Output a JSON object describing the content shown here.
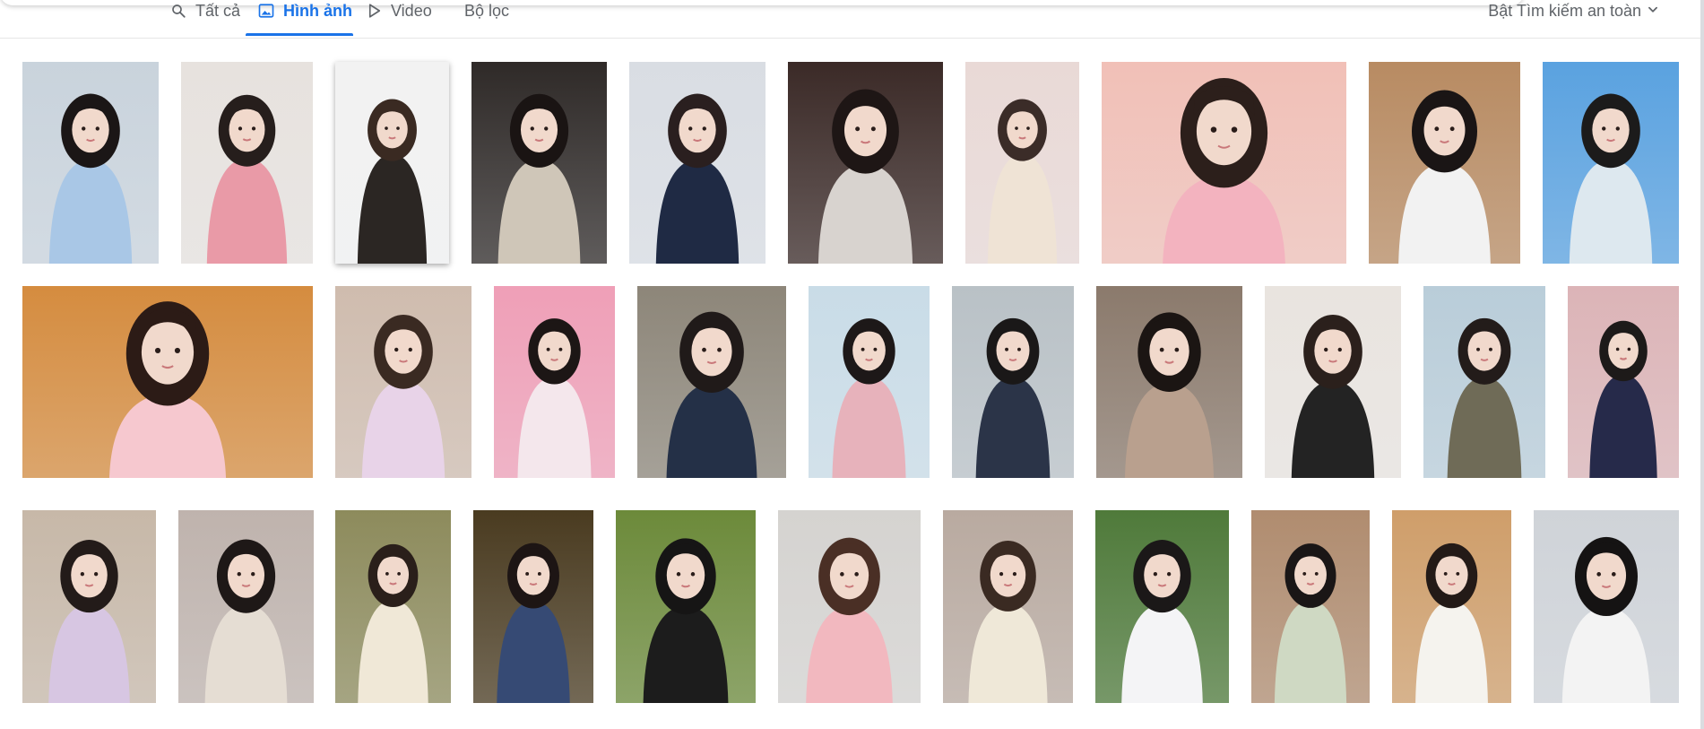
{
  "tabs": [
    {
      "label": "Tất cả",
      "icon": "search-icon",
      "active": false
    },
    {
      "label": "Hình ảnh",
      "icon": "image-icon",
      "active": true
    },
    {
      "label": "Video",
      "icon": "play-icon",
      "active": false
    },
    {
      "label": "Bộ lọc",
      "icon": "",
      "active": false
    }
  ],
  "safe_search": {
    "label": "Bật Tìm kiếm an toàn",
    "icon": "chevron-down-icon"
  },
  "colors": {
    "accent": "#1a73e8",
    "text": "#5f6368",
    "tile_bg": "#eef1f5"
  },
  "images": [
    {
      "row": 1,
      "tones": [
        "#c9d3dc",
        "#1b1616",
        "#a9c7e6"
      ]
    },
    {
      "row": 1,
      "tones": [
        "#e7e2de",
        "#261e1c",
        "#e99aa7"
      ]
    },
    {
      "row": 1,
      "tones": [
        "#f2f2f2",
        "#3a2a22",
        "#2b2623"
      ]
    },
    {
      "row": 1,
      "tones": [
        "#2f2a28",
        "#1a1413",
        "#cfc6b8"
      ]
    },
    {
      "row": 1,
      "tones": [
        "#d9dde3",
        "#2a1f1f",
        "#1f2a44"
      ]
    },
    {
      "row": 1,
      "tones": [
        "#3b2a27",
        "#1e1615",
        "#d8d3cf"
      ]
    },
    {
      "row": 1,
      "tones": [
        "#e9d9d6",
        "#3b2c28",
        "#efe3d5"
      ]
    },
    {
      "row": 1,
      "tones": [
        "#f1c0b7",
        "#2c1f1b",
        "#f3b3bf"
      ]
    },
    {
      "row": 1,
      "tones": [
        "#b88b62",
        "#1a1515",
        "#f2f2f2"
      ]
    },
    {
      "row": 1,
      "tones": [
        "#5aa2e0",
        "#1c1b1b",
        "#dde8ef"
      ]
    },
    {
      "row": 2,
      "tones": [
        "#d58c3f",
        "#2c1b16",
        "#f6c8cf"
      ]
    },
    {
      "row": 2,
      "tones": [
        "#cfbcae",
        "#3a2a22",
        "#e8d3e8"
      ]
    },
    {
      "row": 2,
      "tones": [
        "#ef9fb7",
        "#1c1615",
        "#f4e7ec"
      ]
    },
    {
      "row": 2,
      "tones": [
        "#8d8679",
        "#201a19",
        "#243047"
      ]
    },
    {
      "row": 2,
      "tones": [
        "#c9dce7",
        "#1d1818",
        "#e7b2bb"
      ]
    },
    {
      "row": 2,
      "tones": [
        "#b9c1c6",
        "#1a1818",
        "#2b3448"
      ]
    },
    {
      "row": 2,
      "tones": [
        "#8b7a6c",
        "#1b1513",
        "#b9a08e"
      ]
    },
    {
      "row": 2,
      "tones": [
        "#e9e4df",
        "#2b201c",
        "#232323"
      ]
    },
    {
      "row": 2,
      "tones": [
        "#b9cdd9",
        "#231c1a",
        "#6f6b57"
      ]
    },
    {
      "row": 2,
      "tones": [
        "#dcb4b7",
        "#1d1a19",
        "#262a4a"
      ]
    },
    {
      "row": 3,
      "tones": [
        "#c7b8a8",
        "#231b19",
        "#d7c6e2"
      ]
    },
    {
      "row": 3,
      "tones": [
        "#bfb3ad",
        "#1e1817",
        "#e5ddd3"
      ]
    },
    {
      "row": 3,
      "tones": [
        "#8d8b5c",
        "#2a1f1a",
        "#f0e8d7"
      ]
    },
    {
      "row": 3,
      "tones": [
        "#4a3b20",
        "#1d1514",
        "#364a74"
      ]
    },
    {
      "row": 3,
      "tones": [
        "#6c8a3a",
        "#161515",
        "#1c1c1c"
      ]
    },
    {
      "row": 3,
      "tones": [
        "#d5d3d0",
        "#4a2f25",
        "#f2b8bf"
      ]
    },
    {
      "row": 3,
      "tones": [
        "#b9aaa0",
        "#3a2a22",
        "#efe8d8"
      ]
    },
    {
      "row": 3,
      "tones": [
        "#4f7a3a",
        "#1b1818",
        "#f4f4f6"
      ]
    },
    {
      "row": 3,
      "tones": [
        "#b08c6f",
        "#1a1616",
        "#cfd9c3"
      ]
    },
    {
      "row": 3,
      "tones": [
        "#cf9e6a",
        "#231a17",
        "#f5f3ee"
      ]
    },
    {
      "row": 3,
      "tones": [
        "#cfd3d8",
        "#151313",
        "#f3f3f3"
      ]
    }
  ]
}
